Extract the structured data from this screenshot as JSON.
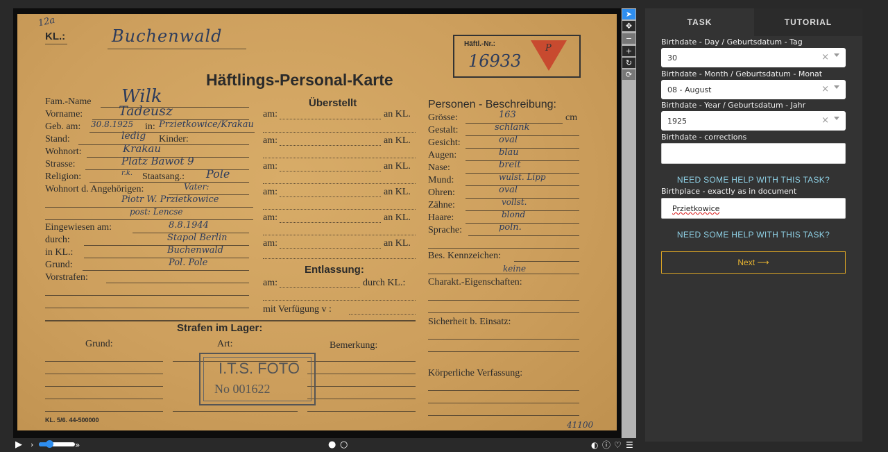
{
  "card": {
    "kl_label": "KL.:",
    "kl_value": "Buchenwald",
    "corner_note": "12a",
    "haeftl_label": "Häftl.-Nr.:",
    "haeftl_number": "16933",
    "triangle_letter": "P",
    "title": "Häftlings-Personal-Karte",
    "labels": {
      "fam_name": "Fam.-Name",
      "vorname": "Vorname:",
      "geb_am": "Geb. am:",
      "in": "in:",
      "stand": "Stand:",
      "kinder": "Kinder:",
      "wohnort": "Wohnort:",
      "strasse": "Strasse:",
      "religion": "Religion:",
      "staatsang": "Staatsang.:",
      "wohnort_angeh": "Wohnort d. Angehörigen:",
      "eingewiesen": "Eingewiesen am:",
      "durch": "durch:",
      "in_kl": "in KL.:",
      "grund": "Grund:",
      "vorstrafen": "Vorstrafen:",
      "ueberstellt": "Überstellt",
      "am": "am:",
      "an_kl": "an KL.",
      "entlassung": "Entlassung:",
      "durch_kl": "durch KL.:",
      "mit_verfuegung": "mit Verfügung v :",
      "personen_beschreibung": "Personen - Beschreibung:",
      "groesse": "Grösse:",
      "cm": "cm",
      "gestalt": "Gestalt:",
      "gesicht": "Gesicht:",
      "augen": "Augen:",
      "nase": "Nase:",
      "mund": "Mund:",
      "ohren": "Ohren:",
      "zaehne": "Zähne:",
      "haare": "Haare:",
      "sprache": "Sprache:",
      "bes_kennzeichen": "Bes. Kennzeichen:",
      "charakt": "Charakt.-Eigenschaften:",
      "sicherheit": "Sicherheit b. Einsatz:",
      "koerperliche": "Körperliche Verfassung:",
      "strafen": "Strafen im Lager:",
      "strafen_grund": "Grund:",
      "strafen_art": "Art:",
      "bemerkung": "Bemerkung:",
      "footer": "KL. 5/6. 44-500000"
    },
    "values": {
      "fam_name": "Wilk",
      "vorname": "Tadeusz",
      "geb_am": "30.8.1925",
      "in": "Przietkowice/Krakau",
      "stand": "ledig",
      "wohnort": "Krakau",
      "strasse": "Platz Bawot 9",
      "religion": "r.k.",
      "staatsang": "Pole",
      "angeh1": "Vater:",
      "angeh2": "Piotr W. Przietkowice",
      "angeh3": "post: Lencse",
      "eingewiesen": "8.8.1944",
      "durch": "Stapol Berlin",
      "in_kl": "Buchenwald",
      "grund": "Pol. Pole",
      "groesse": "163",
      "gestalt": "schlank",
      "gesicht": "oval",
      "augen": "blau",
      "nase": "breit",
      "mund": "wulst. Lipp",
      "ohren": "oval",
      "zaehne": "vollst.",
      "haare": "blond",
      "sprache": "poln.",
      "bes_kennzeichen": "keine",
      "bottom_right": "41100"
    },
    "stamp_line1": "I.T.S. FOTO",
    "stamp_line2": "No 001622"
  },
  "panel": {
    "tabs": {
      "task": "TASK",
      "tutorial": "TUTORIAL"
    },
    "day_label": "Birthdate - Day / Geburtsdatum - Tag",
    "day_value": "30",
    "month_label": "Birthdate - Month / Geburtsdatum - Monat",
    "month_value": "08 - August",
    "year_label": "Birthdate - Year / Geburtsdatum - Jahr",
    "year_value": "1925",
    "corrections_label": "Birthdate - corrections",
    "corrections_value": "",
    "help_text": "NEED SOME HELP WITH THIS TASK?",
    "birthplace_label": "Birthplace - exactly as in document",
    "birthplace_value": "Przietkowice",
    "clear_symbol": "×",
    "next_label": "Next ⟶"
  },
  "icons": {
    "pointer": "pointer-icon",
    "move": "move-icon",
    "zoom_out": "zoom-out-icon",
    "zoom_in": "zoom-in-icon",
    "rotate": "rotate-icon",
    "reset": "reset-icon",
    "play": "play-icon",
    "contrast": "contrast-icon",
    "info": "info-icon",
    "favorite": "heart-icon",
    "list": "list-icon"
  }
}
